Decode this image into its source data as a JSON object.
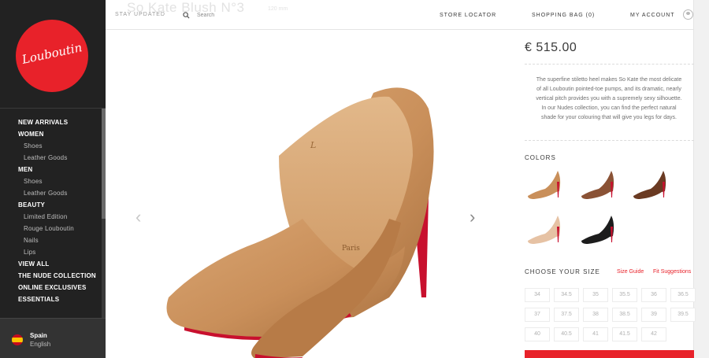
{
  "sidebar": {
    "logo_text": "Louboutin",
    "nav": [
      {
        "label": "NEW ARRIVALS",
        "level": "top"
      },
      {
        "label": "WOMEN",
        "level": "top"
      },
      {
        "label": "Shoes",
        "level": "sub"
      },
      {
        "label": "Leather Goods",
        "level": "sub"
      },
      {
        "label": "MEN",
        "level": "top"
      },
      {
        "label": "Shoes",
        "level": "sub"
      },
      {
        "label": "Leather Goods",
        "level": "sub"
      },
      {
        "label": "BEAUTY",
        "level": "top"
      },
      {
        "label": "Limited Edition",
        "level": "sub"
      },
      {
        "label": "Rouge Louboutin",
        "level": "sub"
      },
      {
        "label": "Nails",
        "level": "sub"
      },
      {
        "label": "Lips",
        "level": "sub"
      },
      {
        "label": "VIEW ALL",
        "level": "top"
      },
      {
        "label": "THE NUDE COLLECTION",
        "level": "top-multi"
      },
      {
        "label": "ONLINE EXCLUSIVES",
        "level": "top"
      },
      {
        "label": "ESSENTIALS",
        "level": "top"
      }
    ],
    "locale": {
      "country": "Spain",
      "language": "English"
    }
  },
  "header": {
    "ghost_title": "So Kate Blush N°3",
    "ghost_sub": "120 mm",
    "stay_updated": "STAY UPDATED",
    "search_placeholder": "Search",
    "store_locator": "STORE LOCATOR",
    "shopping_bag": "SHOPPING BAG (0)",
    "my_account": "MY ACCOUNT"
  },
  "gallery": {
    "prev_glyph": "‹",
    "next_glyph": "›",
    "insole_brand": "Paris"
  },
  "product": {
    "price": "€ 515.00",
    "description": "The superfine stiletto heel makes So Kate the most delicate of all Louboutin pointed-toe pumps, and its dramatic, nearly vertical pitch provides you with a supremely sexy silhouette. In our Nudes collection, you can find the perfect natural shade for your colouring that will give you legs for days.",
    "colors_title": "COLORS",
    "colors": [
      {
        "name": "camel",
        "hex": "#c98f5a"
      },
      {
        "name": "brown",
        "hex": "#8a5235"
      },
      {
        "name": "dark-brown",
        "hex": "#6a3a22"
      },
      {
        "name": "nude",
        "hex": "#e6c2a4"
      },
      {
        "name": "black",
        "hex": "#1c1c1c"
      }
    ],
    "size_title": "CHOOSE YOUR SIZE",
    "size_guide": "Size Guide",
    "fit_suggestions": "Fit Suggestions",
    "sizes": [
      "34",
      "34.5",
      "35",
      "35.5",
      "36",
      "36.5",
      "37",
      "37.5",
      "38",
      "38.5",
      "39",
      "39.5",
      "40",
      "40.5",
      "41",
      "41.5",
      "42"
    ]
  },
  "colors": {
    "brand_red": "#e8222a",
    "sidebar_bg": "#222222",
    "shoe_tan": "#c98f5a",
    "sole_red": "#c8102e"
  }
}
